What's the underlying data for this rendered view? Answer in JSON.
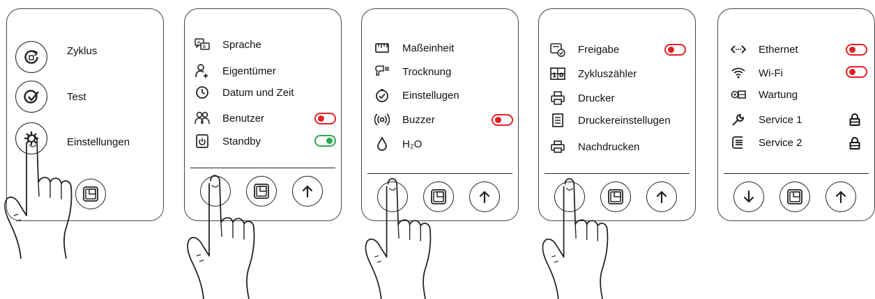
{
  "panel1": {
    "items": [
      {
        "label": "Zyklus",
        "icon": "cycle-icon"
      },
      {
        "label": "Test",
        "icon": "test-check-icon"
      },
      {
        "label": "Einstellungen",
        "icon": "settings-gear-icon"
      }
    ]
  },
  "panel2": {
    "items": [
      {
        "label": "Sprache",
        "icon": "language-icon"
      },
      {
        "label": "Eigentümer",
        "icon": "owner-add-icon"
      },
      {
        "label": "Datum und Zeit",
        "icon": "clock-icon"
      },
      {
        "label": "Benutzer",
        "icon": "users-icon",
        "toggle": "off"
      },
      {
        "label": "Standby",
        "icon": "standby-icon",
        "toggle": "on"
      }
    ]
  },
  "panel3": {
    "items": [
      {
        "label": "Maßeinheit",
        "icon": "ruler-icon"
      },
      {
        "label": "Trocknung",
        "icon": "dryer-icon"
      },
      {
        "label": "Einstellugen",
        "icon": "check-circle-icon"
      },
      {
        "label": "Buzzer",
        "icon": "buzzer-icon",
        "toggle": "off"
      },
      {
        "label": "H₂O",
        "icon": "water-drop-icon"
      }
    ]
  },
  "panel4": {
    "items": [
      {
        "label": "Freigabe",
        "icon": "release-icon",
        "toggle": "off"
      },
      {
        "label": "Zykluszähler",
        "icon": "counter-icon"
      },
      {
        "label": "Drucker",
        "icon": "printer-icon"
      },
      {
        "label": "Druckereinstellugen",
        "icon": "printer-settings-icon"
      },
      {
        "label": "Nachdrucken",
        "icon": "reprint-icon"
      }
    ]
  },
  "panel5": {
    "items": [
      {
        "label": "Ethernet",
        "icon": "ethernet-icon",
        "toggle": "off"
      },
      {
        "label": "Wi-Fi",
        "icon": "wifi-icon",
        "toggle": "off"
      },
      {
        "label": "Wartung",
        "icon": "maintenance-icon"
      },
      {
        "label": "Service 1",
        "icon": "wrench-icon",
        "locked": true
      },
      {
        "label": "Service 2",
        "icon": "service-icon",
        "locked": true
      }
    ]
  },
  "colors": {
    "toggle_off": "#e52025",
    "toggle_on": "#2fa84f",
    "line": "#222222"
  }
}
